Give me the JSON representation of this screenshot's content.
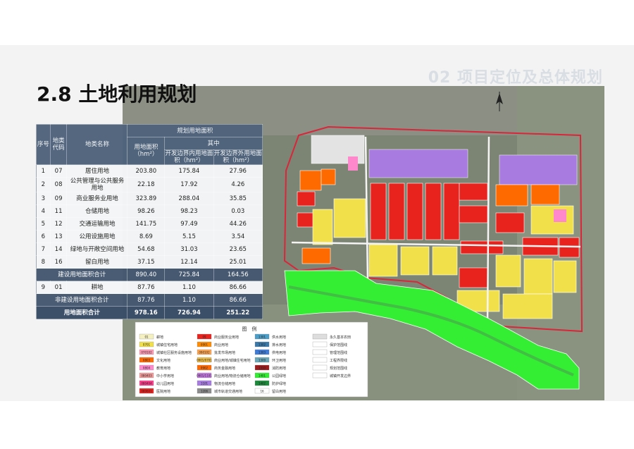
{
  "header": {
    "section": "02 项目定位及总体规划"
  },
  "title": "2.8 土地利用规划",
  "table": {
    "headers": {
      "no": "序号",
      "code": "地类代码",
      "name": "地类名称",
      "group": "规划用地面积",
      "area": "用地面积（hm²）",
      "sub": "其中",
      "inside": "开发边界内用地面积（hm²）",
      "outside": "开发边界外用地面积（hm²）"
    },
    "rows": [
      {
        "no": "1",
        "code": "07",
        "name": "居住用地",
        "area": "203.80",
        "inside": "175.84",
        "outside": "27.96"
      },
      {
        "no": "2",
        "code": "08",
        "name": "公共管理与公共服务用地",
        "area": "22.18",
        "inside": "17.92",
        "outside": "4.26"
      },
      {
        "no": "3",
        "code": "09",
        "name": "商业服务业用地",
        "area": "323.89",
        "inside": "288.04",
        "outside": "35.85"
      },
      {
        "no": "4",
        "code": "11",
        "name": "仓储用地",
        "area": "98.26",
        "inside": "98.23",
        "outside": "0.03"
      },
      {
        "no": "5",
        "code": "12",
        "name": "交通运输用地",
        "area": "141.75",
        "inside": "97.49",
        "outside": "44.26"
      },
      {
        "no": "6",
        "code": "13",
        "name": "公用设施用地",
        "area": "8.69",
        "inside": "5.15",
        "outside": "3.54"
      },
      {
        "no": "7",
        "code": "14",
        "name": "绿地与开敞空间用地",
        "area": "54.68",
        "inside": "31.03",
        "outside": "23.65"
      },
      {
        "no": "8",
        "code": "16",
        "name": "留白用地",
        "area": "37.15",
        "inside": "12.14",
        "outside": "25.01"
      }
    ],
    "subtotal_build": {
      "label": "建设用地面积合计",
      "area": "890.40",
      "inside": "725.84",
      "outside": "164.56"
    },
    "row9": {
      "no": "9",
      "code": "01",
      "name": "耕地",
      "area": "87.76",
      "inside": "1.10",
      "outside": "86.66"
    },
    "subtotal_nonbuild": {
      "label": "非建设用地面积合计",
      "area": "87.76",
      "inside": "1.10",
      "outside": "86.66"
    },
    "total": {
      "label": "用地面积合计",
      "area": "978.16",
      "inside": "726.94",
      "outside": "251.22"
    }
  },
  "map": {
    "legend_title": "图　例",
    "legend_items": [
      "耕地",
      "城镇住宅用地",
      "城镇社区服务设施用地",
      "文化用地",
      "教育用地",
      "中小学用地",
      "幼儿园用地",
      "医院用地",
      "商业服务业用地",
      "商业用地",
      "批发市场用地",
      "商业用地/城镇住宅用地",
      "商务金融用地",
      "商业用地/物流仓储用地",
      "物流仓储用地",
      "城市轨道交通用地",
      "供水用地",
      "排水用地",
      "供电用地",
      "环卫用地",
      "消防用地",
      "公园绿地",
      "防护绿地",
      "留白用地",
      "永久基本农田",
      "保护范围线",
      "管理范围线",
      "工程界限线",
      "规划范围线",
      "城镇开发边界"
    ],
    "legend_codes": [
      "01",
      "0701",
      "070102",
      "0803",
      "0804",
      "080403",
      "080404",
      "080601",
      "09",
      "0901",
      "090102",
      "0901/0701",
      "0902",
      "0901/1101",
      "1101",
      "1206",
      "1301",
      "1302",
      "1303",
      "1309",
      "1310",
      "1401",
      "1402",
      "16"
    ],
    "colors": {
      "residential": "#f2e04a",
      "commercial": "#e8231e",
      "business": "#ff6a00",
      "warehouse": "#a77be0",
      "green": "#33ee33",
      "pink": "#ff88cc",
      "blue": "#2f4fb0",
      "gray": "#cfcfcf",
      "table_bg": "#4a5e76"
    }
  }
}
